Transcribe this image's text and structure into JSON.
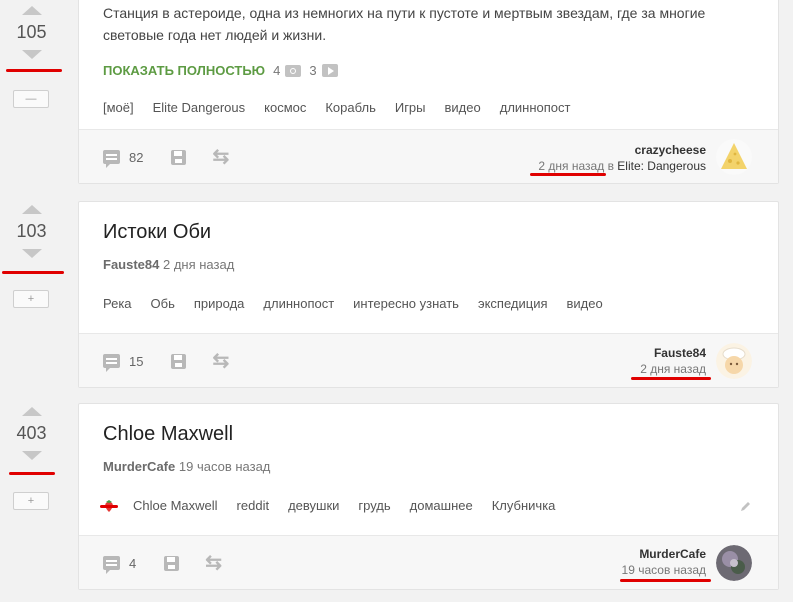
{
  "posts": [
    {
      "score": "105",
      "toggle": "—",
      "text_line1": "Станция в астероиде, одна из немногих на пути к пустоте и мертвым звездам, где за многие",
      "text_line2": "световые года нет людей и жизни.",
      "show_more": "ПОКАЗАТЬ ПОЛНОСТЬЮ",
      "photo_count": "4",
      "video_count": "3",
      "tags": [
        "[моё]",
        "Elite Dangerous",
        "космос",
        "Корабль",
        "Игры",
        "видео",
        "длиннопост"
      ],
      "comments": "82",
      "author": "crazycheese",
      "time": "2 дня назад",
      "in_word": "в",
      "community": "Elite: Dangerous",
      "avatar_icon": "cheese-avatar"
    },
    {
      "score": "103",
      "toggle": "+",
      "title": "Истоки Оби",
      "meta_author": "Fauste84",
      "meta_time": "2 дня назад",
      "tags": [
        "Река",
        "Обь",
        "природа",
        "длиннопост",
        "интересно узнать",
        "экспедиция",
        "видео"
      ],
      "comments": "15",
      "author": "Fauste84",
      "time": "2 дня назад",
      "avatar_icon": "chef-avatar"
    },
    {
      "score": "403",
      "toggle": "+",
      "title": "Chloe Maxwell",
      "meta_author": "MurderCafe",
      "meta_time": "19 часов назад",
      "tag_icon": "strawberry-icon",
      "tags": [
        "Chloe Maxwell",
        "reddit",
        "девушки",
        "грудь",
        "домашнее",
        "Клубничка"
      ],
      "comments": "4",
      "author": "MurderCafe",
      "time": "19 часов назад",
      "avatar_icon": "photo-avatar"
    }
  ],
  "colors": {
    "accent_green": "#5d9b43",
    "annotation_red": "#e00000"
  }
}
